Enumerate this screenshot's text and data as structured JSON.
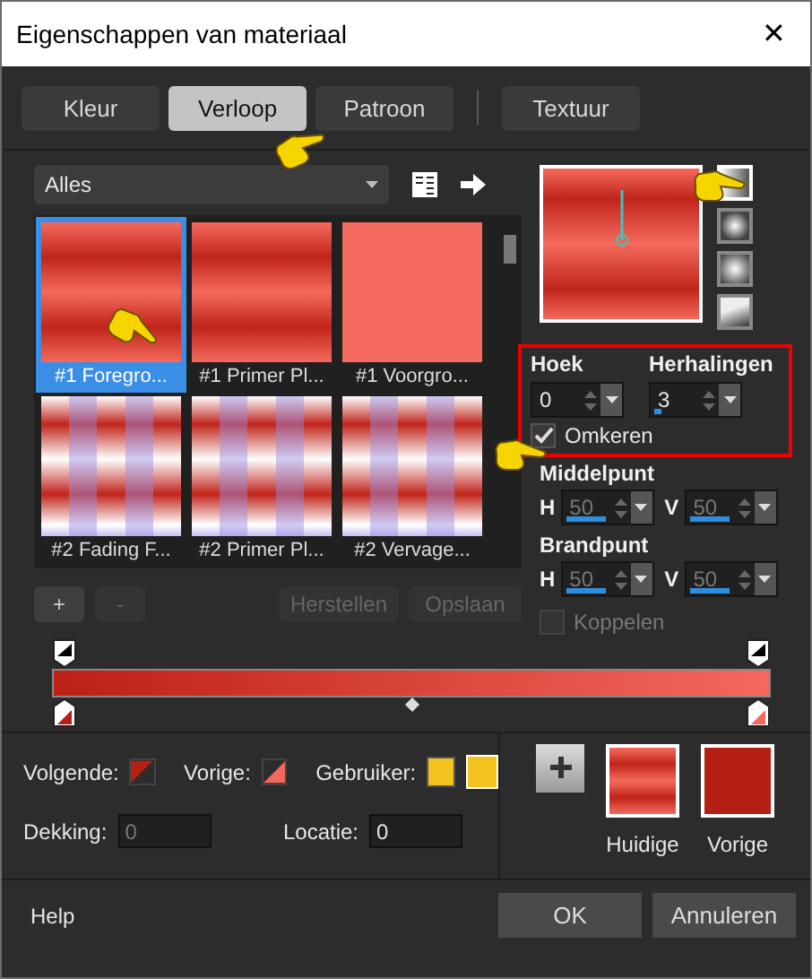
{
  "window": {
    "title": "Eigenschappen van materiaal",
    "close": "✕"
  },
  "tabs": [
    {
      "label": "Kleur",
      "selected": false
    },
    {
      "label": "Verloop",
      "selected": true
    },
    {
      "label": "Patroon",
      "selected": false
    },
    {
      "label": "Textuur",
      "selected": false
    }
  ],
  "category": {
    "value": "Alles"
  },
  "gallery": [
    {
      "label": "#1 Foregro...",
      "kind": "stripes",
      "selected": true
    },
    {
      "label": "#1 Primer Pl...",
      "kind": "stripes",
      "selected": false
    },
    {
      "label": "#1 Voorgro...",
      "kind": "solid",
      "selected": false
    },
    {
      "label": "#2 Fading F...",
      "kind": "checker",
      "selected": false
    },
    {
      "label": "#2 Primer Pl...",
      "kind": "checker",
      "selected": false
    },
    {
      "label": "#2 Vervage...",
      "kind": "checker",
      "selected": false
    }
  ],
  "gallery_buttons": [
    {
      "label": "+",
      "disabled": false
    },
    {
      "label": "-",
      "disabled": true
    },
    {
      "label": "Herstellen",
      "disabled": true
    },
    {
      "label": "Opslaan",
      "disabled": true
    }
  ],
  "styles": [
    {
      "kind": "linear",
      "selected": true
    },
    {
      "kind": "rectangular",
      "selected": false
    },
    {
      "kind": "sunburst",
      "selected": false
    },
    {
      "kind": "radial",
      "selected": false
    }
  ],
  "angle": {
    "label": "Hoek",
    "value": "0"
  },
  "repeats": {
    "label": "Herhalingen",
    "value": "3",
    "level": 0.1
  },
  "invert": {
    "label": "Omkeren",
    "checked": true
  },
  "center": {
    "label": "Middelpunt",
    "h": {
      "label": "H",
      "value": "50",
      "level": 0.5,
      "disabled": true
    },
    "v": {
      "label": "V",
      "value": "50",
      "level": 0.5,
      "disabled": true
    }
  },
  "focal": {
    "label": "Brandpunt",
    "h": {
      "label": "H",
      "value": "50",
      "level": 0.5,
      "disabled": true
    },
    "v": {
      "label": "V",
      "value": "50",
      "level": 0.5,
      "disabled": true
    }
  },
  "link": {
    "label": "Koppelen",
    "checked": false,
    "disabled": true
  },
  "stops": {
    "next": {
      "label": "Volgende:",
      "color": "#b52015"
    },
    "prev": {
      "label": "Vorige:",
      "color": "#f4685e"
    },
    "user": {
      "label": "Gebruiker:",
      "color": "#f2c21e"
    }
  },
  "opacity": {
    "label": "Dekking:",
    "value": "0",
    "disabled": true
  },
  "location": {
    "label": "Locatie:",
    "value": "0"
  },
  "current": {
    "label": "Huidige"
  },
  "previous": {
    "label": "Vorige"
  },
  "buttons": {
    "help": "Help",
    "ok": "OK",
    "cancel": "Annuleren"
  }
}
